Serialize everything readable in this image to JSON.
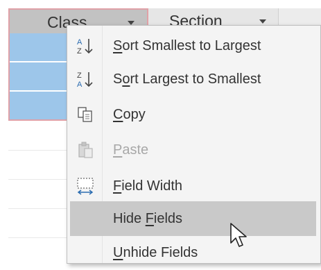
{
  "datasheet": {
    "columns": [
      {
        "label": "Class"
      },
      {
        "label": "Section"
      }
    ]
  },
  "context_menu": {
    "items": [
      {
        "icon": "sort-ascending-icon",
        "pre": "",
        "key": "S",
        "post": "ort Smallest to Largest",
        "enabled": true,
        "highlighted": false
      },
      {
        "icon": "sort-descending-icon",
        "pre": "S",
        "key": "o",
        "post": "rt Largest to Smallest",
        "enabled": true,
        "highlighted": false
      },
      {
        "icon": "copy-icon",
        "pre": "",
        "key": "C",
        "post": "opy",
        "enabled": true,
        "highlighted": false
      },
      {
        "icon": "paste-icon",
        "pre": "",
        "key": "P",
        "post": "aste",
        "enabled": false,
        "highlighted": false
      },
      {
        "icon": "field-width-icon",
        "pre": "",
        "key": "F",
        "post": "ield Width",
        "enabled": true,
        "highlighted": false
      },
      {
        "icon": "",
        "pre": "Hide ",
        "key": "F",
        "post": "ields",
        "enabled": true,
        "highlighted": true
      },
      {
        "icon": "",
        "pre": "",
        "key": "U",
        "post": "nhide Fields",
        "enabled": true,
        "highlighted": false
      }
    ]
  },
  "colors": {
    "selected_cells": "#9dc6ea",
    "selection_border": "#e0a1a7",
    "menu_bg": "#f4f4f4",
    "menu_highlight": "#c9c9c9"
  }
}
